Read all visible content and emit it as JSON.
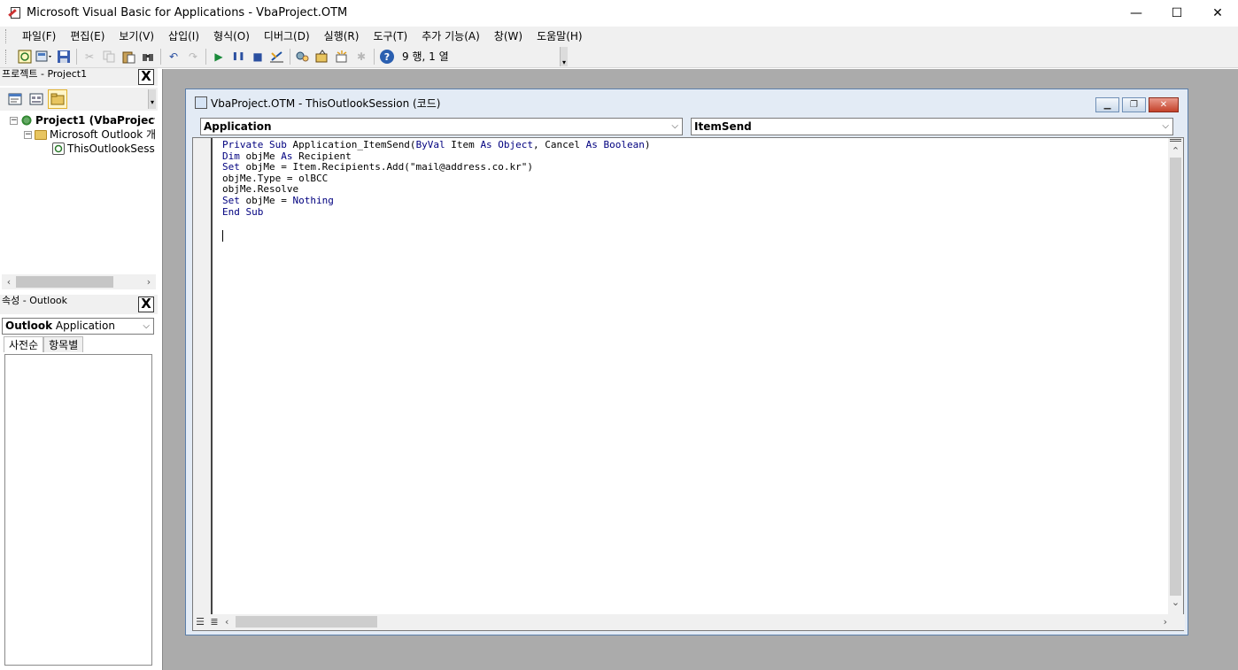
{
  "window": {
    "title": "Microsoft Visual Basic for Applications - VbaProject.OTM",
    "minimize": "—",
    "maximize": "☐",
    "close": "✕"
  },
  "menu": [
    "파일(F)",
    "편집(E)",
    "보기(V)",
    "삽입(I)",
    "형식(O)",
    "디버그(D)",
    "실행(R)",
    "도구(T)",
    "추가 기능(A)",
    "창(W)",
    "도움말(H)"
  ],
  "toolbar": {
    "status": "9 행, 1 열",
    "icons": [
      "view-outlook-icon",
      "insert-module-icon",
      "save-icon",
      "cut-icon",
      "copy-icon",
      "paste-icon",
      "find-icon",
      "undo-icon",
      "redo-icon",
      "run-icon",
      "break-icon",
      "reset-icon",
      "design-mode-icon",
      "project-explorer-icon",
      "properties-icon",
      "object-browser-icon",
      "toolbox-icon",
      "help-icon"
    ]
  },
  "project_panel": {
    "title": "프로젝트 - Project1",
    "close": "X",
    "tree": [
      {
        "label": "Project1 (VbaProject",
        "bold": true,
        "level": 0
      },
      {
        "label": "Microsoft Outlook 개",
        "bold": false,
        "level": 1
      },
      {
        "label": "ThisOutlookSess",
        "bold": false,
        "level": 2
      }
    ]
  },
  "properties_panel": {
    "title": "속성 - Outlook",
    "close": "X",
    "object_bold": "Outlook",
    "object_type": "Application",
    "tabs": [
      "사전순",
      "항목별"
    ]
  },
  "code_window": {
    "title": "VbaProject.OTM - ThisOutlookSession (코드)",
    "object_combo": "Application",
    "procedure_combo": "ItemSend",
    "code_lines": [
      "Private Sub Application_ItemSend(ByVal Item As Object, Cancel As Boolean)",
      "Dim objMe As Recipient",
      "Set objMe = Item.Recipients.Add(\"mail@address.co.kr\")",
      "objMe.Type = olBCC",
      "objMe.Resolve",
      "Set objMe = Nothing",
      "End Sub"
    ]
  },
  "colors": {
    "keyword": "#00007f",
    "mdi_background": "#ababab",
    "code_window_frame": "#e3ebf5"
  }
}
